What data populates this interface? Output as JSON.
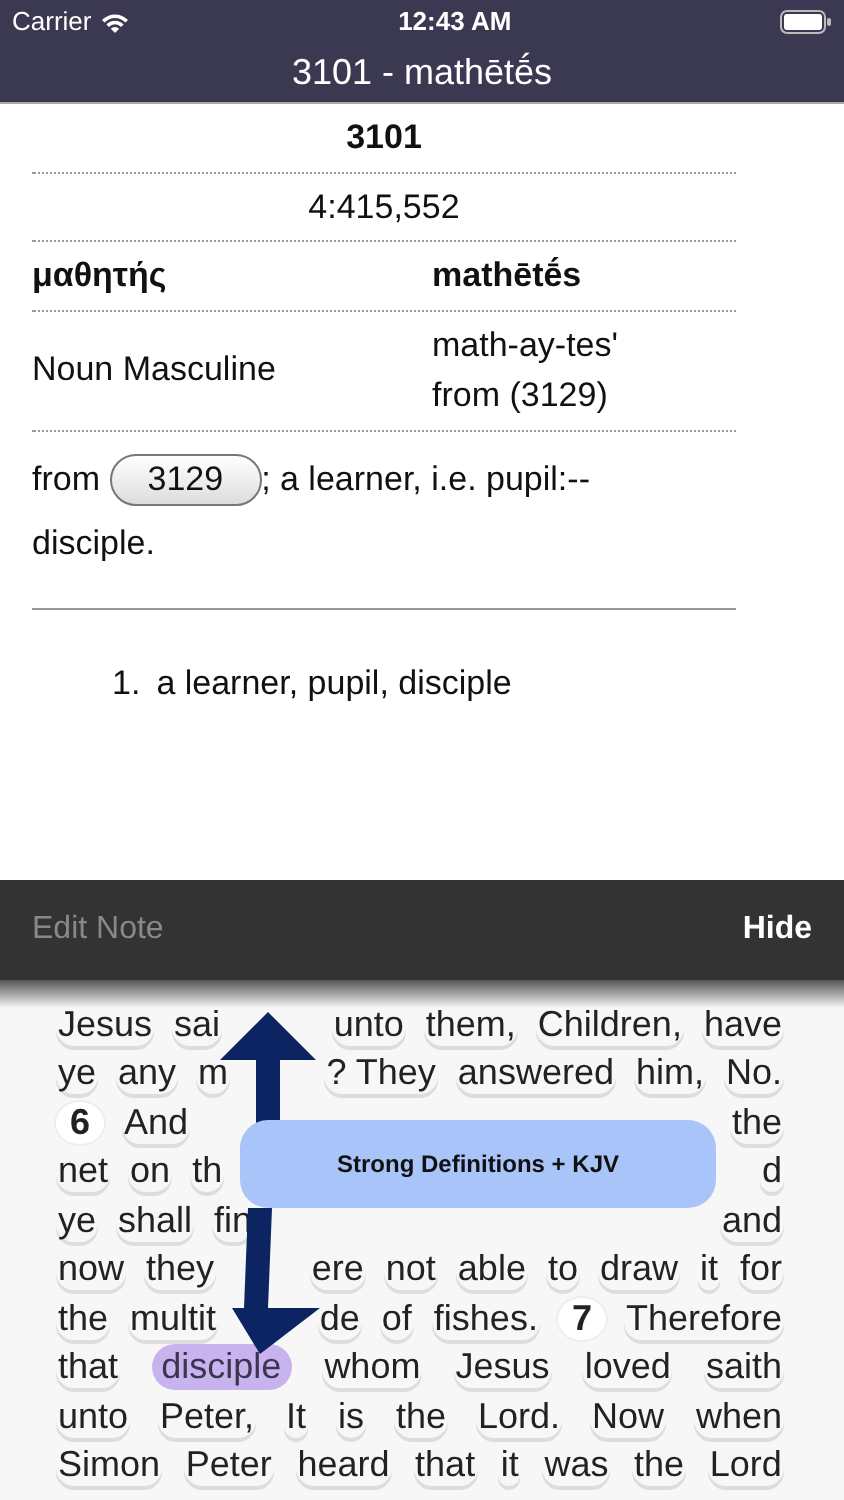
{
  "status_bar": {
    "carrier": "Carrier",
    "time": "12:43 AM"
  },
  "nav_bar": {
    "title": "3101 - mathētḗs"
  },
  "entry": {
    "number": "3101",
    "frequency": "4:415,552",
    "greek": "μαθητής",
    "transliteration": "mathētḗs",
    "part_of_speech": "Noun Masculine",
    "pronunciation": [
      "math-ay-tes'",
      "from (3129)"
    ],
    "definition": {
      "before": "from",
      "link": "3129",
      "after": "; a learner, i.e. pupil:--disciple."
    },
    "senses": [
      {
        "number": "1.",
        "text": "a learner, pupil, disciple"
      }
    ]
  },
  "toolbar": [
    {
      "label": "Edit Note",
      "disabled": true
    },
    {
      "label": "Hide",
      "disabled": false
    }
  ],
  "verse_lines": [
    {
      "left": [
        {
          "text": "Jesus",
          "kind": "word",
          "selected": false
        },
        {
          "text": "sai",
          "kind": "word",
          "selected": false
        }
      ],
      "right": [
        {
          "text": "unto",
          "kind": "word",
          "selected": false
        },
        {
          "text": "them,",
          "kind": "word",
          "selected": false
        },
        {
          "text": "Children,",
          "kind": "word",
          "selected": false
        },
        {
          "text": "have",
          "kind": "word",
          "selected": false
        }
      ]
    },
    {
      "left": [
        {
          "text": "ye",
          "kind": "word",
          "selected": false
        },
        {
          "text": "any",
          "kind": "word",
          "selected": false
        },
        {
          "text": "m",
          "kind": "word",
          "selected": false
        }
      ],
      "right": [
        {
          "text": "? They",
          "kind": "word",
          "selected": false
        },
        {
          "text": "answered",
          "kind": "word",
          "selected": false
        },
        {
          "text": "him,",
          "kind": "word",
          "selected": false
        },
        {
          "text": "No.",
          "kind": "word",
          "selected": false
        }
      ]
    },
    {
      "left": [
        {
          "text": "6",
          "kind": "verse",
          "selected": false
        },
        {
          "text": "And",
          "kind": "word",
          "selected": false
        }
      ],
      "right": [
        {
          "text": "the",
          "kind": "word",
          "selected": false
        }
      ]
    },
    {
      "left": [
        {
          "text": "net",
          "kind": "word",
          "selected": false
        },
        {
          "text": "on",
          "kind": "word",
          "selected": false
        },
        {
          "text": "th",
          "kind": "word",
          "selected": false
        }
      ],
      "right": [
        {
          "text": "d",
          "kind": "word",
          "selected": false
        }
      ]
    },
    {
      "left": [
        {
          "text": "ye",
          "kind": "word",
          "selected": false
        },
        {
          "text": "shall",
          "kind": "word",
          "selected": false
        },
        {
          "text": "fin",
          "kind": "word",
          "selected": false
        }
      ],
      "right": [
        {
          "text": "and",
          "kind": "word",
          "selected": false
        }
      ]
    },
    {
      "left": [
        {
          "text": "now",
          "kind": "word",
          "selected": false
        },
        {
          "text": "they",
          "kind": "word",
          "selected": false
        }
      ],
      "right": [
        {
          "text": "ere",
          "kind": "word",
          "selected": false
        },
        {
          "text": "not",
          "kind": "word",
          "selected": false
        },
        {
          "text": "able",
          "kind": "word",
          "selected": false
        },
        {
          "text": "to",
          "kind": "word",
          "selected": false
        },
        {
          "text": "draw",
          "kind": "word",
          "selected": false
        },
        {
          "text": "it",
          "kind": "word",
          "selected": false
        },
        {
          "text": "for",
          "kind": "word",
          "selected": false
        }
      ]
    },
    {
      "left": [
        {
          "text": "the",
          "kind": "word",
          "selected": false
        },
        {
          "text": "multit",
          "kind": "word",
          "selected": false
        }
      ],
      "right": [
        {
          "text": "de",
          "kind": "word",
          "selected": false
        },
        {
          "text": "of",
          "kind": "word",
          "selected": false
        },
        {
          "text": "fishes.",
          "kind": "word",
          "selected": false
        },
        {
          "text": "7",
          "kind": "verse",
          "selected": false
        },
        {
          "text": "Therefore",
          "kind": "word",
          "selected": false
        }
      ]
    },
    {
      "left": [
        {
          "text": "that",
          "kind": "word",
          "selected": false
        },
        {
          "text": "disciple",
          "kind": "word",
          "selected": true
        },
        {
          "text": "whom",
          "kind": "word",
          "selected": false
        },
        {
          "text": "Jesus",
          "kind": "word",
          "selected": false
        },
        {
          "text": "loved",
          "kind": "word",
          "selected": false
        },
        {
          "text": "saith",
          "kind": "word",
          "selected": false
        }
      ]
    },
    {
      "left": [
        {
          "text": "unto",
          "kind": "word",
          "selected": false
        },
        {
          "text": "Peter,",
          "kind": "word",
          "selected": false
        },
        {
          "text": "It",
          "kind": "word",
          "selected": false
        },
        {
          "text": "is",
          "kind": "word",
          "selected": false
        },
        {
          "text": "the",
          "kind": "word",
          "selected": false
        },
        {
          "text": "Lord.",
          "kind": "word",
          "selected": false
        },
        {
          "text": "Now",
          "kind": "word",
          "selected": false
        },
        {
          "text": "when",
          "kind": "word",
          "selected": false
        }
      ]
    },
    {
      "left": [
        {
          "text": "Simon",
          "kind": "word",
          "selected": false
        },
        {
          "text": "Peter",
          "kind": "word",
          "selected": false
        },
        {
          "text": "heard",
          "kind": "word",
          "selected": false
        },
        {
          "text": "that",
          "kind": "word",
          "selected": false
        },
        {
          "text": "it",
          "kind": "word",
          "selected": false
        },
        {
          "text": "was",
          "kind": "word",
          "selected": false
        },
        {
          "text": "the",
          "kind": "word",
          "selected": false
        },
        {
          "text": "Lord",
          "kind": "word",
          "selected": false
        }
      ]
    }
  ],
  "callout": {
    "text": "Strong Definitions + KJV"
  }
}
